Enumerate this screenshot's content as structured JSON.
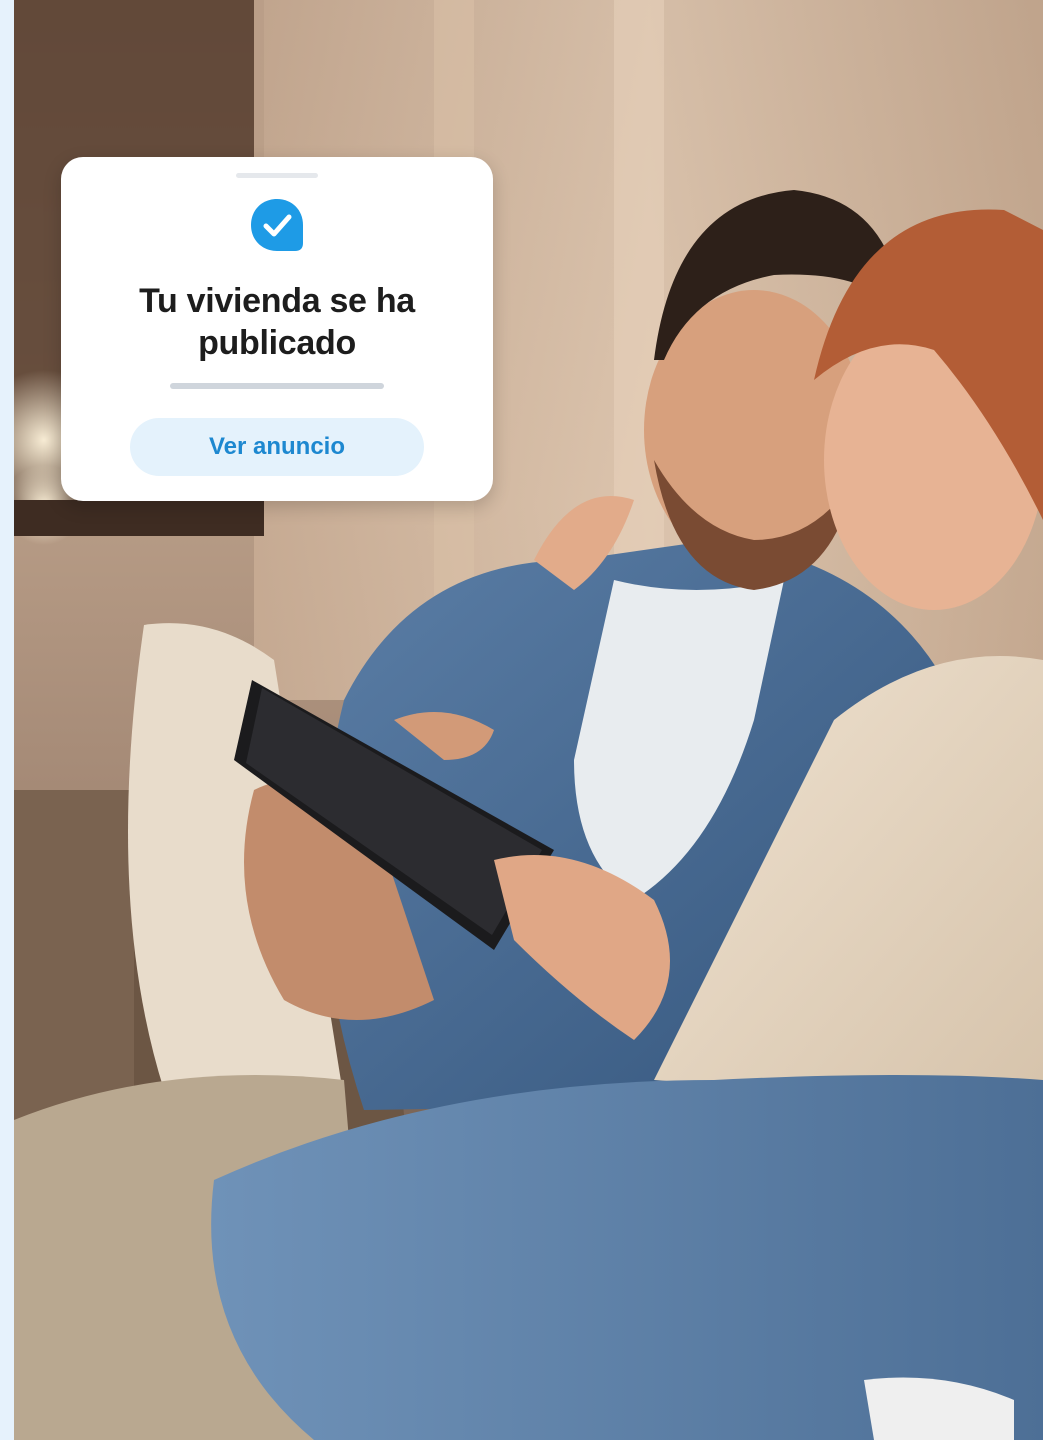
{
  "notification": {
    "title": "Tu vivienda se ha publicado",
    "button_label": "Ver anuncio",
    "icon": "check-badge-icon",
    "accent_color": "#1e9be6",
    "button_bg_color": "#e4f2fc",
    "button_text_color": "#1d88d0"
  },
  "photo": {
    "subject": "couple-on-sofa-with-tablet-photo"
  }
}
